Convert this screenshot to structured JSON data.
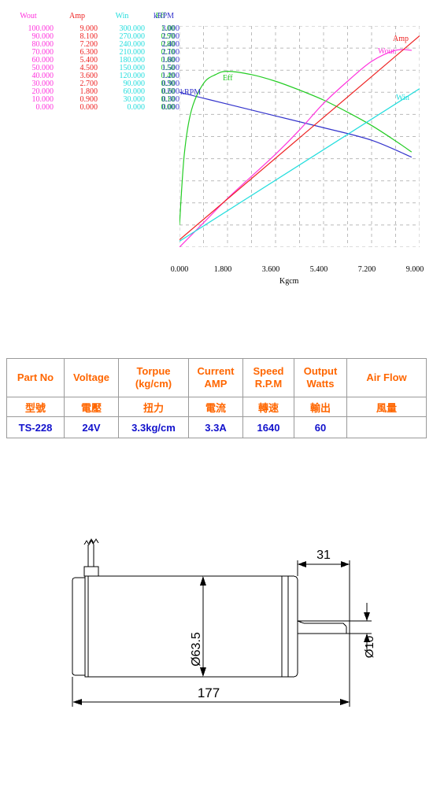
{
  "chart_data": {
    "type": "line",
    "title": "",
    "xlabel": "Kgcm",
    "xlim": [
      0,
      9
    ],
    "xticks": [
      "0.000",
      "1.800",
      "3.600",
      "5.400",
      "7.200",
      "9.000"
    ],
    "grid": true,
    "legend": "inline-curve-labels",
    "axes": [
      {
        "name": "Wout",
        "color": "#ff33dd",
        "ticks": [
          "100.000",
          "90.000",
          "80.000",
          "70.000",
          "60.000",
          "50.000",
          "40.000",
          "30.000",
          "20.000",
          "10.000",
          "0.000"
        ],
        "range": [
          0,
          100
        ]
      },
      {
        "name": "Amp",
        "color": "#ee2222",
        "ticks": [
          "9.000",
          "8.100",
          "7.200",
          "6.300",
          "5.400",
          "4.500",
          "3.600",
          "2.700",
          "1.800",
          "0.900",
          "0.000"
        ],
        "range": [
          0,
          9
        ]
      },
      {
        "name": "Win",
        "color": "#22dddd",
        "ticks": [
          "300.000",
          "270.000",
          "240.000",
          "210.000",
          "180.000",
          "150.000",
          "120.000",
          "90.000",
          "60.000",
          "30.000",
          "0.000"
        ],
        "range": [
          0,
          300
        ]
      },
      {
        "name": "Eff",
        "color": "#22cc22",
        "ticks": [
          "1.00",
          "0.90",
          "0.80",
          "0.70",
          "0.60",
          "0.50",
          "0.40",
          "0.30",
          "0.20",
          "0.10",
          "0.00"
        ],
        "range": [
          0,
          1
        ]
      },
      {
        "name": "kRPM",
        "color": "#3333cc",
        "ticks": [
          "3.000",
          "2.700",
          "2.400",
          "2.100",
          "1.800",
          "1.500",
          "1.200",
          "0.900",
          "0.600",
          "0.300",
          "0.000"
        ],
        "range": [
          0,
          3
        ]
      }
    ],
    "series": [
      {
        "name": "kRPM",
        "color": "#3333cc",
        "label": "kRPM",
        "unit": "kRPM",
        "x": [
          0,
          1.8,
          3.6,
          5.4,
          7.2,
          8.7
        ],
        "y": [
          2.1,
          1.94,
          1.78,
          1.62,
          1.45,
          1.22
        ]
      },
      {
        "name": "Eff",
        "color": "#22cc22",
        "label": "Eff",
        "unit": "Eff",
        "x": [
          0,
          0.18,
          0.45,
          0.9,
          1.35,
          1.8,
          2.7,
          3.6,
          4.5,
          5.4,
          6.3,
          7.2,
          8.1,
          8.7
        ],
        "y": [
          0.1,
          0.42,
          0.62,
          0.74,
          0.78,
          0.795,
          0.78,
          0.75,
          0.71,
          0.665,
          0.61,
          0.55,
          0.48,
          0.43
        ]
      },
      {
        "name": "Wout",
        "color": "#ff33dd",
        "label": "Wout",
        "unit": "Wout",
        "x": [
          0,
          0.9,
          1.8,
          2.7,
          3.6,
          4.5,
          5.4,
          6.3,
          7.2,
          8.1,
          8.7
        ],
        "y": [
          0,
          11,
          22,
          32,
          42,
          53,
          65,
          75,
          84,
          89,
          89
        ]
      },
      {
        "name": "Amp",
        "color": "#ee2222",
        "label": "Amp",
        "unit": "Amp",
        "x": [
          0,
          9
        ],
        "y": [
          0.3,
          8.6
        ]
      },
      {
        "name": "Win",
        "color": "#22dddd",
        "label": "Win",
        "unit": "Win",
        "x": [
          0,
          9
        ],
        "y": [
          8,
          215
        ]
      }
    ]
  },
  "spec_table": {
    "headers_en": [
      "Part No",
      "Voltage",
      "Torpue\n(kg/cm)",
      "Current\nAMP",
      "Speed\nR.P.M",
      "Output\nWatts",
      "Air  Flow"
    ],
    "h_part_no": "Part No",
    "h_voltage": "Voltage",
    "h_torque_1": "Torpue",
    "h_torque_2": "(kg/cm)",
    "h_current_1": "Current",
    "h_current_2": "AMP",
    "h_speed_1": "Speed",
    "h_speed_2": "R.P.M",
    "h_output_1": "Output",
    "h_output_2": "Watts",
    "h_airflow": "Air  Flow",
    "cn_part_no": "型號",
    "cn_voltage": "電壓",
    "cn_torque": "扭力",
    "cn_current": "電流",
    "cn_speed": "轉速",
    "cn_output": "輸出",
    "cn_airflow": "風量",
    "v_part_no": "TS-228",
    "v_voltage": "24V",
    "v_torque": "3.3kg/cm",
    "v_current": "3.3A",
    "v_speed": "1640",
    "v_output": "60",
    "v_airflow": ""
  },
  "drawing": {
    "dim_diameter_body": "Ø63.5",
    "dim_length_total": "177",
    "dim_shaft_length": "31",
    "dim_shaft_diameter": "Ø10"
  },
  "colors": {
    "wout": "#ff33dd",
    "amp": "#ee2222",
    "win": "#22dddd",
    "eff": "#22cc22",
    "krpm": "#3333cc",
    "table_header": "#ff6600",
    "table_value": "#1111cc",
    "grid": "#bbbbbb"
  }
}
